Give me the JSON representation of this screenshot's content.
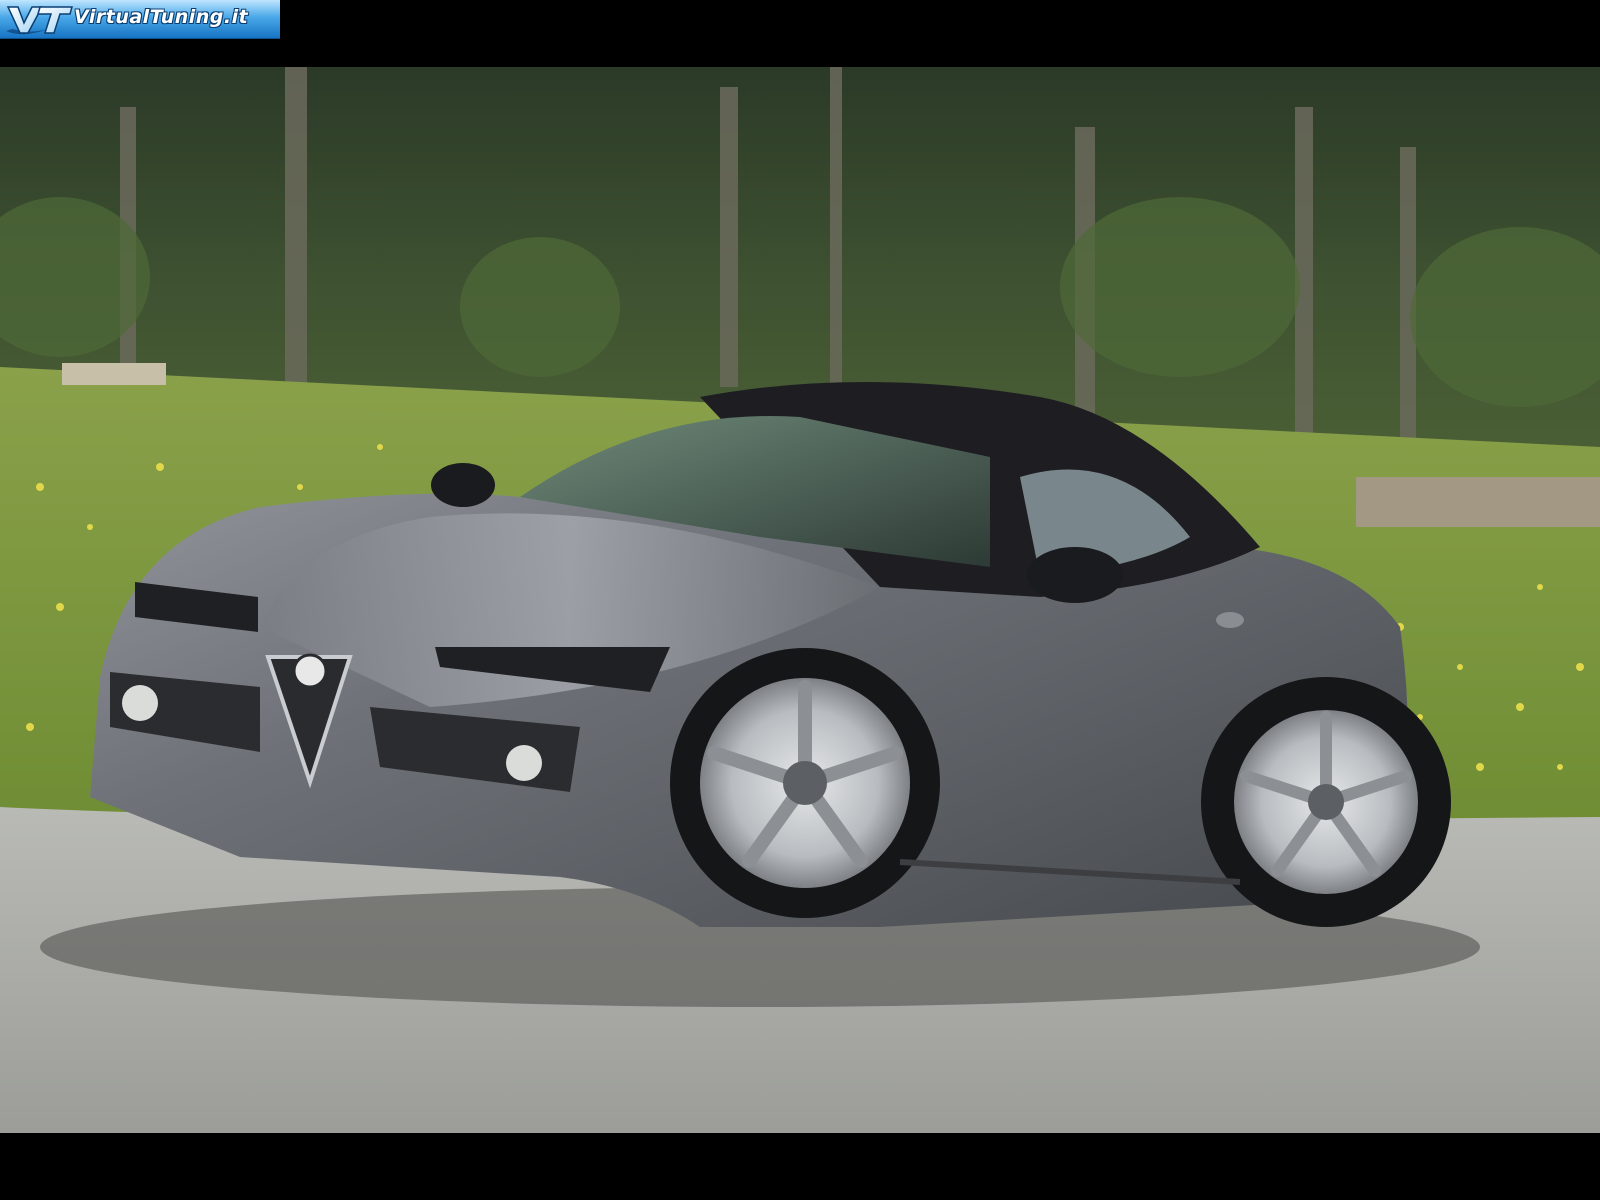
{
  "logo": {
    "text": "VirtualTuning.it",
    "icon": "vt-logo-icon"
  },
  "photo": {
    "subject": "car-photo"
  },
  "colors": {
    "banner_top": "#bfe6ff",
    "banner_bottom": "#1674c4",
    "letterbox": "#000000"
  }
}
